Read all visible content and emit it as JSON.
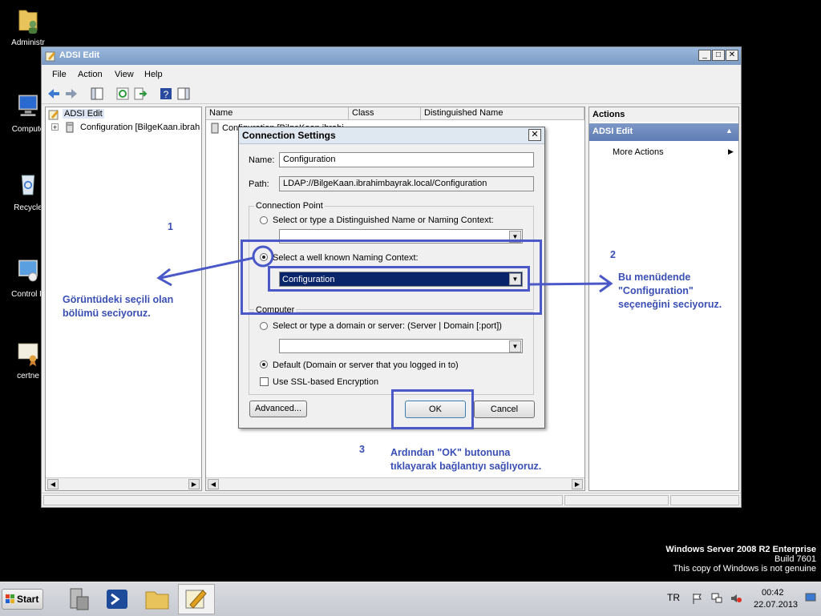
{
  "desktop": {
    "icons": [
      {
        "label": "Administr"
      },
      {
        "label": "Compute"
      },
      {
        "label": "Recycle"
      },
      {
        "label": "Control P"
      },
      {
        "label": "certne"
      }
    ]
  },
  "window": {
    "title": "ADSI Edit",
    "controls": {
      "minimize": "_",
      "maximize": "□",
      "close": "✕"
    },
    "menu": [
      "File",
      "Action",
      "View",
      "Help"
    ],
    "tree": {
      "root": "ADSI Edit",
      "child": "Configuration [BilgeKaan.ibrahi"
    },
    "list": {
      "columns": [
        "Name",
        "Class",
        "Distinguished Name"
      ],
      "rows": [
        {
          "name": "Configuration [BilgeKaan.ibrahi"
        }
      ]
    },
    "actions": {
      "header": "Actions",
      "section": "ADSI Edit",
      "items": [
        "More Actions"
      ]
    }
  },
  "dialog": {
    "title": "Connection Settings",
    "name_label": "Name:",
    "name_value": "Configuration",
    "path_label": "Path:",
    "path_value": "LDAP://BilgeKaan.ibrahimbayrak.local/Configuration",
    "connection_point": {
      "legend": "Connection Point",
      "option_dn": "Select or type a Distinguished Name or Naming Context:",
      "option_wellknown": "Select a well known Naming Context:",
      "wellknown_value": "Configuration"
    },
    "computer": {
      "legend": "Computer",
      "option_server": "Select or type a domain or server: (Server | Domain [:port])",
      "option_default": "Default (Domain or server that you logged in to)",
      "ssl": "Use SSL-based Encryption"
    },
    "buttons": {
      "advanced": "Advanced...",
      "ok": "OK",
      "cancel": "Cancel"
    }
  },
  "annotations": {
    "n1": "1",
    "t1": [
      "Görüntüdeki seçili olan",
      "bölümü seciyoruz."
    ],
    "n2": "2",
    "t2": [
      "Bu menüdende",
      "\"Configuration\"",
      "seçeneğini seciyoruz."
    ],
    "n3": "3",
    "t3": [
      "Ardından \"OK\" butonuna",
      "tıklayarak bağlantıyı sağlıyoruz."
    ],
    "color": "#3a4fb5"
  },
  "watermark": {
    "line1": "Windows Server 2008 R2 Enterprise",
    "line2": "Build 7601",
    "line3": "This copy of Windows is not genuine"
  },
  "taskbar": {
    "start": "Start",
    "language": "TR",
    "time": "00:42",
    "date": "22.07.2013"
  }
}
